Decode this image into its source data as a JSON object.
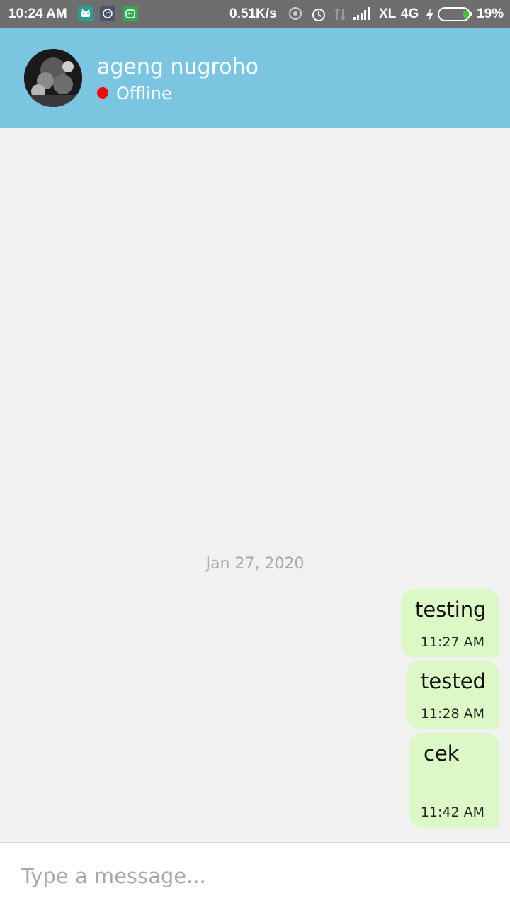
{
  "status_bar": {
    "time": "10:24 AM",
    "speed": "0.51K/s",
    "carrier": "XL",
    "network": "4G",
    "battery": "19%",
    "icons": [
      "android-icon",
      "cat-app-icon",
      "bot-app-icon",
      "hotspot-icon",
      "alarm-icon",
      "data-arrows-icon",
      "signal-icon",
      "charging-icon",
      "battery-icon"
    ]
  },
  "header": {
    "contact_name": "ageng nugroho",
    "status": "Offline",
    "status_color": "#ff0000",
    "bg_color": "#7bc5e0"
  },
  "chat": {
    "date_separator": "Jan 27, 2020",
    "messages": [
      {
        "text": "testing",
        "time": "11:27 AM"
      },
      {
        "text": "tested",
        "time": "11:28 AM"
      },
      {
        "text": "cek",
        "time": "11:42 AM"
      }
    ]
  },
  "composer": {
    "placeholder": "Type a message..."
  },
  "colors": {
    "bubble": "#dbf8c6",
    "background": "#f1f1f1"
  }
}
